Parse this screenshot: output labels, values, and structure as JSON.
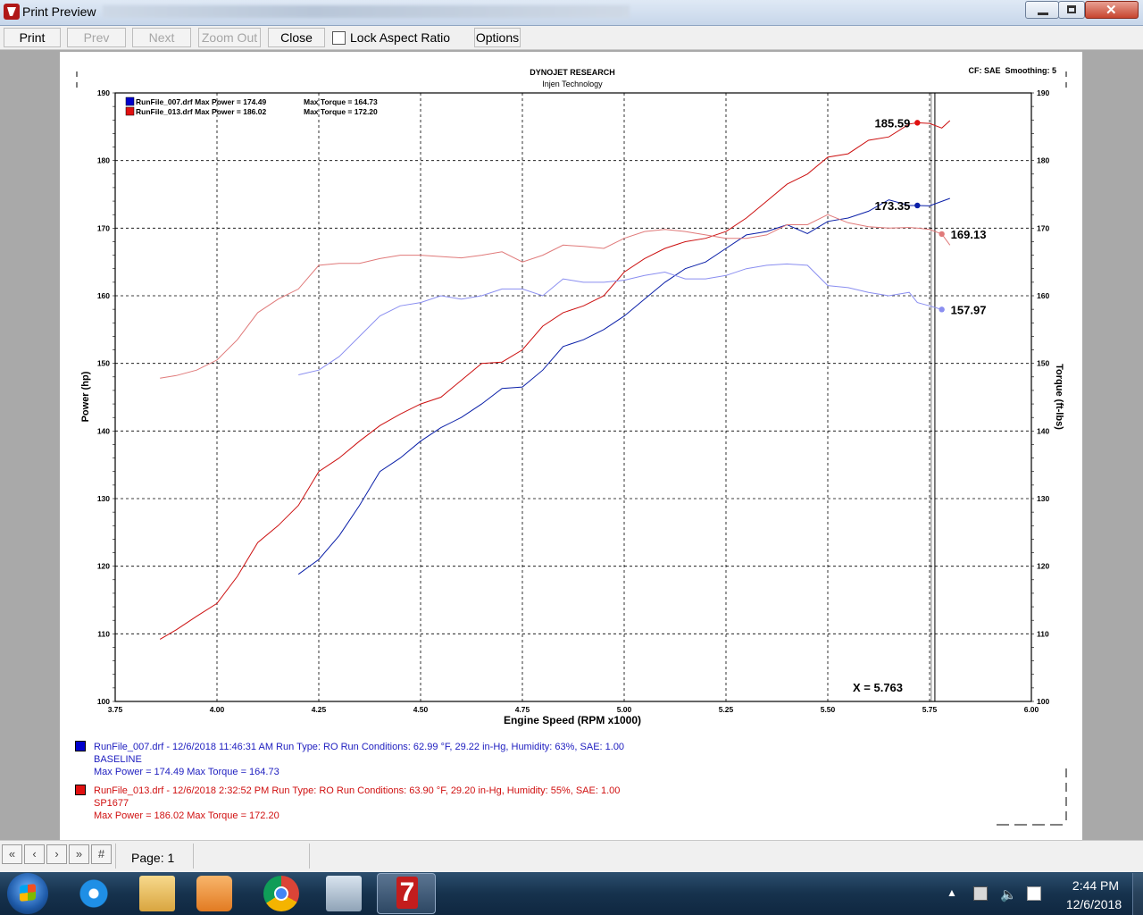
{
  "window": {
    "title": "Print Preview"
  },
  "toolbar": {
    "print": "Print",
    "prev": "Prev",
    "next": "Next",
    "zoom_out": "Zoom Out",
    "close": "Close",
    "lock_aspect": "Lock Aspect Ratio",
    "lock_checked": false,
    "options": "Options"
  },
  "report": {
    "header_title": "DYNOJET RESEARCH",
    "header_subtitle": "Injen Technology",
    "cf_info": "CF: SAE  Smoothing: 5",
    "cursor_label": "X = 5.763",
    "legend": [
      {
        "text": "RunFile_007.drf Max Power = 174.49",
        "torque": "Max Torque = 164.73",
        "color": "#0000cc"
      },
      {
        "text": "RunFile_013.drf Max Power = 186.02",
        "torque": "Max Torque = 172.20",
        "color": "#e01010"
      }
    ],
    "runs": [
      {
        "line1": "RunFile_007.drf - 12/6/2018 11:46:31 AM  Run Type: RO  Run Conditions: 62.99 °F, 29.22 in-Hg,  Humidity:  63%, SAE: 1.00",
        "line2": "BASELINE",
        "line3": "Max Power = 174.49  Max Torque = 164.73",
        "color": "#0000cc"
      },
      {
        "line1": "RunFile_013.drf - 12/6/2018 2:32:52 PM  Run Type: RO  Run Conditions: 63.90 °F, 29.20 in-Hg,  Humidity:  55%, SAE: 1.00",
        "line2": "SP1677",
        "line3": "Max Power = 186.02  Max Torque = 172.20",
        "color": "#e01010"
      }
    ]
  },
  "chart_data": {
    "type": "line",
    "xlabel": "Engine Speed (RPM x1000)",
    "ylabel": "Power (hp)",
    "y2label": "Torque (ft-lbs)",
    "xlim": [
      3.75,
      6.0
    ],
    "ylim": [
      100,
      190
    ],
    "x_ticks": [
      "3.75",
      "4.00",
      "4.25",
      "4.50",
      "4.75",
      "5.00",
      "5.25",
      "5.50",
      "5.75",
      "6.00"
    ],
    "y_ticks": [
      "100",
      "110",
      "120",
      "130",
      "140",
      "150",
      "160",
      "170",
      "180",
      "190"
    ],
    "grid": true,
    "cursor_x": 5.763,
    "series": [
      {
        "name": "RunFile_007.drf Power",
        "color": "#0a1fa8",
        "x": [
          4.2,
          4.25,
          4.3,
          4.35,
          4.4,
          4.45,
          4.5,
          4.55,
          4.6,
          4.65,
          4.7,
          4.75,
          4.8,
          4.85,
          4.9,
          4.95,
          5.0,
          5.05,
          5.1,
          5.15,
          5.2,
          5.25,
          5.3,
          5.35,
          5.4,
          5.45,
          5.5,
          5.55,
          5.6,
          5.65,
          5.7,
          5.72,
          5.75,
          5.8
        ],
        "y": [
          118.8,
          121,
          124.5,
          129,
          134,
          136,
          138.5,
          140.5,
          142,
          144,
          146.3,
          146.5,
          149,
          152.5,
          153.5,
          155,
          157,
          159.5,
          162,
          164,
          165,
          167,
          169,
          169.5,
          170.5,
          169.2,
          171,
          171.5,
          172.5,
          174.2,
          173.35,
          173.35,
          173.3,
          174.4
        ]
      },
      {
        "name": "RunFile_013.drf Power",
        "color": "#cc1010",
        "x": [
          3.86,
          3.9,
          3.95,
          4.0,
          4.05,
          4.1,
          4.15,
          4.2,
          4.25,
          4.3,
          4.35,
          4.4,
          4.45,
          4.5,
          4.55,
          4.6,
          4.65,
          4.7,
          4.75,
          4.8,
          4.85,
          4.9,
          4.95,
          5.0,
          5.05,
          5.1,
          5.15,
          5.2,
          5.25,
          5.3,
          5.35,
          5.4,
          5.45,
          5.5,
          5.55,
          5.6,
          5.65,
          5.7,
          5.72,
          5.75,
          5.78,
          5.8
        ],
        "y": [
          109.2,
          110.6,
          112.6,
          114.5,
          118.5,
          123.5,
          126,
          129,
          134,
          136,
          138.5,
          140.8,
          142.5,
          144,
          145,
          147.5,
          150,
          150.2,
          152,
          155.5,
          157.5,
          158.5,
          160,
          163.5,
          165.5,
          167,
          168,
          168.5,
          169.5,
          171.5,
          174,
          176.5,
          178,
          180.5,
          181,
          183,
          183.5,
          185.4,
          185.59,
          185.5,
          184.8,
          185.9
        ]
      },
      {
        "name": "RunFile_007.drf Torque",
        "color": "#8a8ef0",
        "x": [
          4.2,
          4.25,
          4.3,
          4.35,
          4.4,
          4.45,
          4.5,
          4.55,
          4.6,
          4.65,
          4.7,
          4.75,
          4.8,
          4.85,
          4.9,
          4.95,
          5.0,
          5.05,
          5.1,
          5.15,
          5.2,
          5.25,
          5.3,
          5.35,
          5.4,
          5.45,
          5.5,
          5.55,
          5.6,
          5.65,
          5.7,
          5.72,
          5.75,
          5.78
        ],
        "y": [
          148.3,
          149,
          151,
          154,
          157,
          158.5,
          159,
          160,
          159.5,
          160,
          161,
          161,
          160,
          162.5,
          162,
          162,
          162.3,
          163,
          163.5,
          162.5,
          162.5,
          163,
          164,
          164.5,
          164.7,
          164.5,
          161.5,
          161.2,
          160.5,
          160,
          160.5,
          159,
          158.5,
          157.97
        ]
      },
      {
        "name": "RunFile_013.drf Torque",
        "color": "#e07a7a",
        "x": [
          3.86,
          3.9,
          3.95,
          4.0,
          4.05,
          4.1,
          4.15,
          4.2,
          4.25,
          4.3,
          4.35,
          4.4,
          4.45,
          4.5,
          4.55,
          4.6,
          4.65,
          4.7,
          4.75,
          4.8,
          4.85,
          4.9,
          4.95,
          5.0,
          5.05,
          5.1,
          5.15,
          5.2,
          5.25,
          5.3,
          5.35,
          5.4,
          5.45,
          5.5,
          5.55,
          5.6,
          5.65,
          5.7,
          5.72,
          5.75,
          5.78,
          5.8
        ],
        "y": [
          147.8,
          148.2,
          149,
          150.5,
          153.5,
          157.5,
          159.5,
          161,
          164.5,
          164.8,
          164.8,
          165.5,
          166,
          166,
          165.8,
          165.6,
          166,
          166.5,
          165,
          166,
          167.5,
          167.3,
          167,
          168.5,
          169.5,
          169.8,
          169.5,
          169,
          168.5,
          168.5,
          169,
          170.5,
          170.5,
          172,
          170.8,
          170.2,
          170,
          170.1,
          170,
          169.8,
          169.13,
          167.5
        ]
      }
    ],
    "annotations": [
      {
        "x": 5.72,
        "y": 185.59,
        "label": "185.59",
        "color": "#e01010",
        "side": "left"
      },
      {
        "x": 5.72,
        "y": 173.35,
        "label": "173.35",
        "color": "#0a1fa8",
        "side": "left"
      },
      {
        "x": 5.78,
        "y": 169.13,
        "label": "169.13",
        "color": "#e07a7a",
        "side": "right"
      },
      {
        "x": 5.78,
        "y": 157.97,
        "label": "157.97",
        "color": "#8a8ef0",
        "side": "right"
      }
    ]
  },
  "statusbar": {
    "page_label": "Page: 1"
  },
  "taskbar": {
    "time": "2:44 PM",
    "date": "12/6/2018"
  }
}
